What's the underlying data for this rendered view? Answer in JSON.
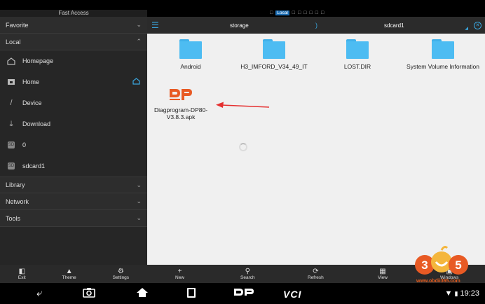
{
  "sidebar": {
    "fast_access": "Fast Access",
    "sections": {
      "favorite": "Favorite",
      "local": "Local",
      "library": "Library",
      "network": "Network",
      "tools": "Tools"
    },
    "local_items": [
      {
        "label": "Homepage",
        "icon": "homepage-icon"
      },
      {
        "label": "Home",
        "icon": "home-folder-icon"
      },
      {
        "label": "Device",
        "icon": "device-icon"
      },
      {
        "label": "Download",
        "icon": "download-icon"
      },
      {
        "label": "0",
        "icon": "storage-icon"
      },
      {
        "label": "sdcard1",
        "icon": "sdcard-icon"
      }
    ],
    "toolbar": {
      "exit": "Exit",
      "theme": "Theme",
      "settings": "Settings"
    }
  },
  "status": {
    "local_tab": "Local"
  },
  "path": {
    "crumb1": "storage",
    "crumb2": "sdcard1"
  },
  "files": [
    {
      "name": "Android",
      "type": "folder"
    },
    {
      "name": "H3_IMFORD_V34_49_IT",
      "type": "folder"
    },
    {
      "name": "LOST.DIR",
      "type": "folder"
    },
    {
      "name": "System Volume Information",
      "type": "folder"
    },
    {
      "name": "Diagprogram-DP80-V3.8.3.apk",
      "type": "apk",
      "icon": "dp-logo-icon"
    }
  ],
  "main_toolbar": {
    "new": "New",
    "search": "Search",
    "refresh": "Refresh",
    "view": "View",
    "windows": "Windows"
  },
  "navbar": {
    "time": "19:23",
    "vci": "VCI"
  },
  "watermark": {
    "text": "www.obdii365.com",
    "number": "365"
  },
  "colors": {
    "accent": "#3aa7e0",
    "folder": "#4dbcf2",
    "dp_logo": "#e85a24",
    "arrow": "#e53030"
  }
}
